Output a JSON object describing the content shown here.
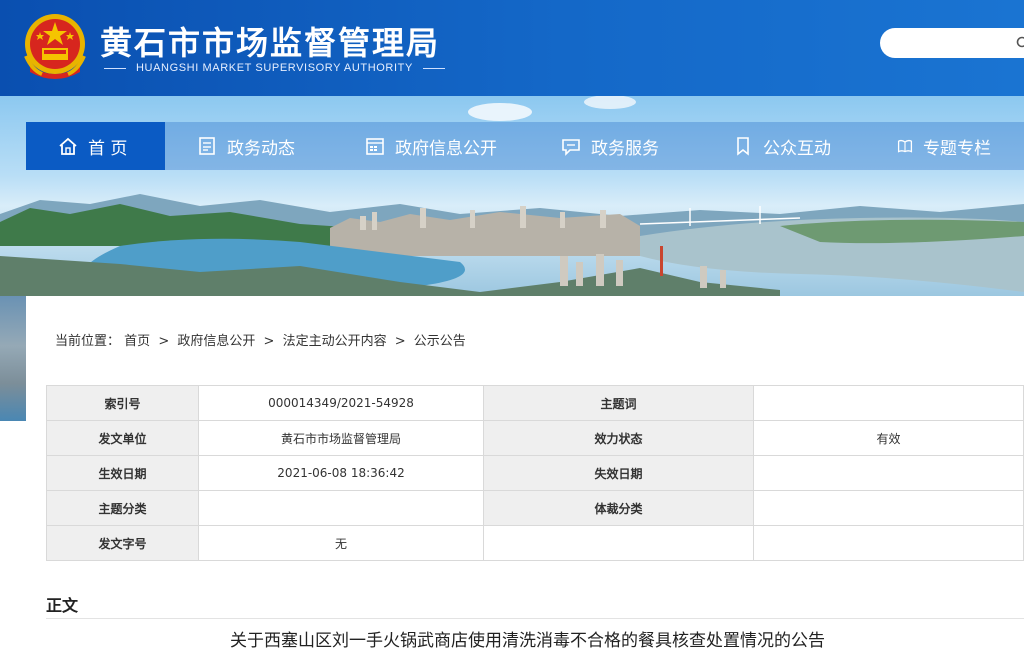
{
  "header": {
    "title": "黄石市市场监督管理局",
    "subtitle": "HUANGSHI MARKET SUPERVISORY AUTHORITY",
    "emblem_icon": "national-emblem-icon",
    "search_placeholder": "",
    "brand_color": "#0a4fb0"
  },
  "nav": {
    "items": [
      {
        "label": "首 页",
        "icon": "home-icon"
      },
      {
        "label": "政务动态",
        "icon": "document-icon"
      },
      {
        "label": "政府信息公开",
        "icon": "calendar-icon"
      },
      {
        "label": "政务服务",
        "icon": "chat-icon"
      },
      {
        "label": "公众互动",
        "icon": "bookmark-icon"
      },
      {
        "label": "专题专栏",
        "icon": "book-icon"
      }
    ]
  },
  "breadcrumb": {
    "prefix": "当前位置：",
    "items": [
      "首页",
      "政府信息公开",
      "法定主动公开内容",
      "公示公告"
    ],
    "separator": ">"
  },
  "info": {
    "rows": [
      {
        "l1": "索引号",
        "v1": "000014349/2021-54928",
        "l2": "主题词",
        "v2": ""
      },
      {
        "l1": "发文单位",
        "v1": "黄石市市场监督管理局",
        "l2": "效力状态",
        "v2": "有效"
      },
      {
        "l1": "生效日期",
        "v1": "2021-06-08 18:36:42",
        "l2": "失效日期",
        "v2": ""
      },
      {
        "l1": "主题分类",
        "v1": "",
        "l2": "体裁分类",
        "v2": ""
      },
      {
        "l1": "发文字号",
        "v1": "无",
        "l2": "",
        "v2": ""
      }
    ]
  },
  "body": {
    "section_title": "正文",
    "doc_title": "关于西塞山区刘一手火锅武商店使用清洗消毒不合格的餐具核查处置情况的公告"
  }
}
